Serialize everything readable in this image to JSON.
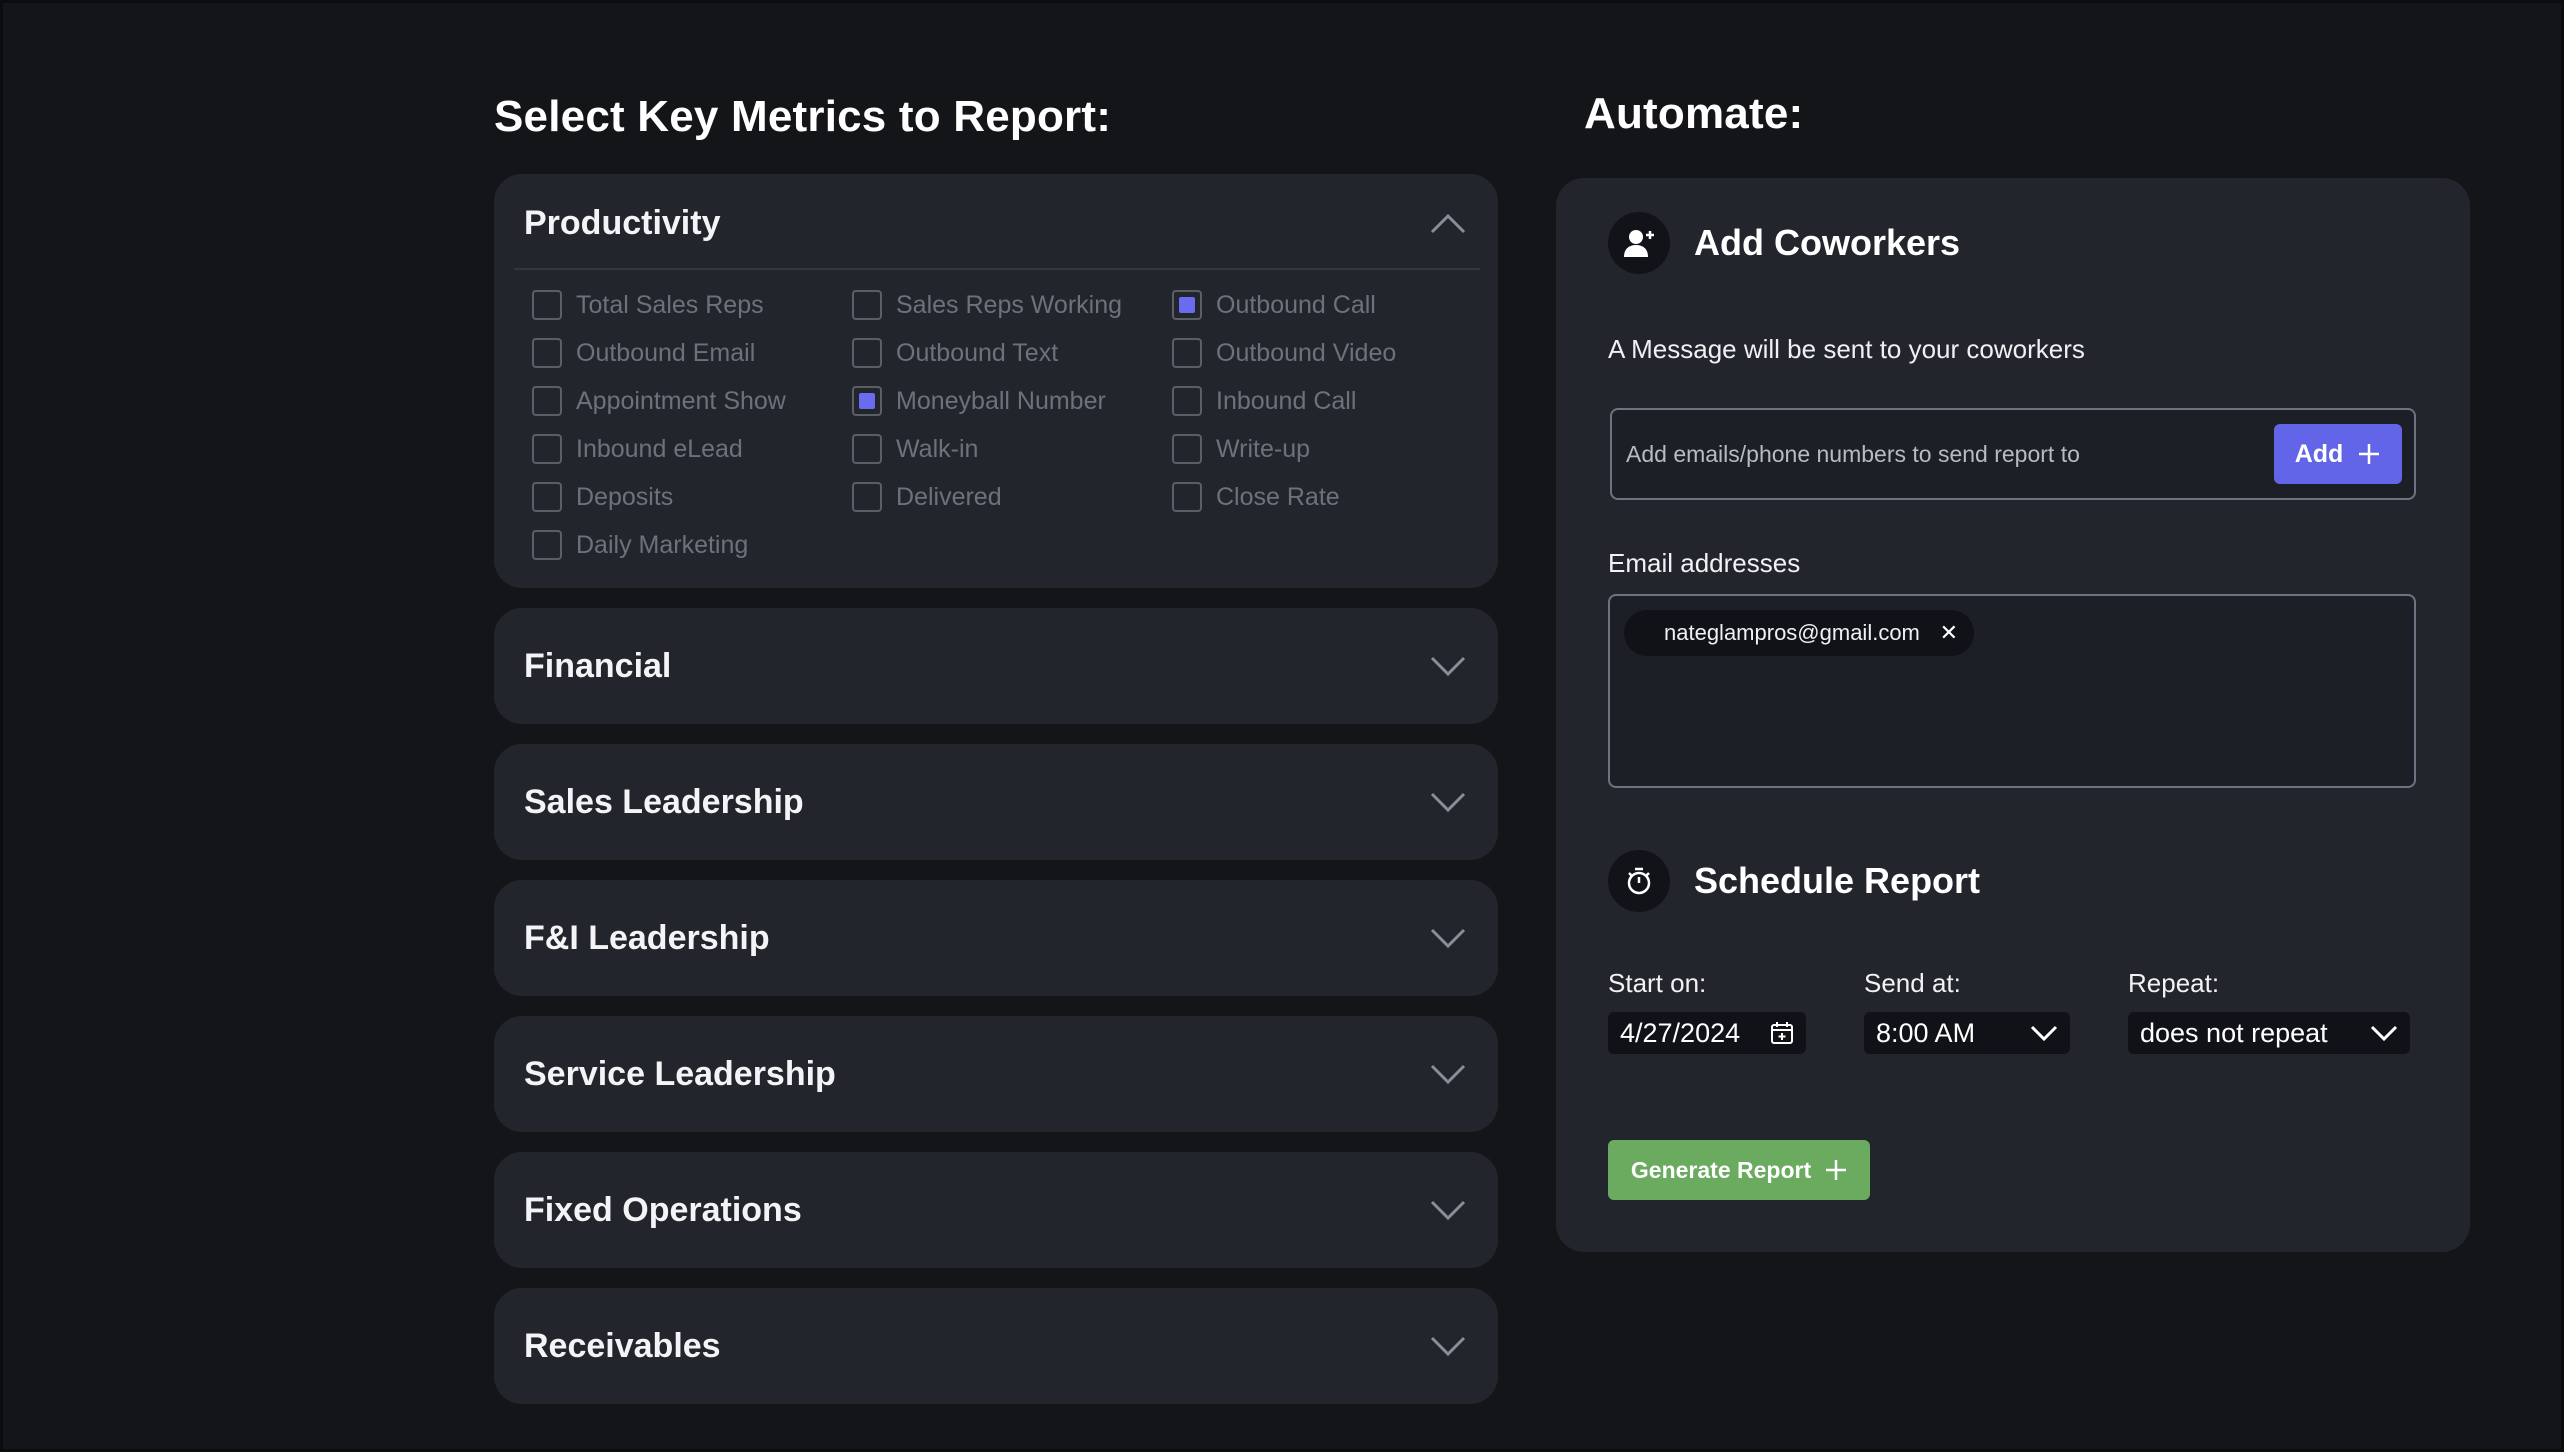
{
  "metrics_section": {
    "title": "Select Key Metrics to Report:",
    "categories": [
      {
        "title": "Productivity",
        "expanded": true,
        "columns": [
          [
            {
              "label": "Total Sales Reps",
              "checked": false
            },
            {
              "label": "Outbound Email",
              "checked": false
            },
            {
              "label": "Appointment Show",
              "checked": false
            },
            {
              "label": "Inbound eLead",
              "checked": false
            },
            {
              "label": "Deposits",
              "checked": false
            },
            {
              "label": "Daily Marketing",
              "checked": false
            }
          ],
          [
            {
              "label": "Sales Reps Working",
              "checked": false
            },
            {
              "label": "Outbound Text",
              "checked": false
            },
            {
              "label": "Moneyball Number",
              "checked": true
            },
            {
              "label": "Walk-in",
              "checked": false
            },
            {
              "label": "Delivered",
              "checked": false
            }
          ],
          [
            {
              "label": "Outbound Call",
              "checked": true
            },
            {
              "label": "Outbound Video",
              "checked": false
            },
            {
              "label": "Inbound Call",
              "checked": false
            },
            {
              "label": "Write-up",
              "checked": false
            },
            {
              "label": "Close Rate",
              "checked": false
            }
          ]
        ]
      },
      {
        "title": "Financial",
        "expanded": false
      },
      {
        "title": "Sales Leadership",
        "expanded": false
      },
      {
        "title": "F&I Leadership",
        "expanded": false
      },
      {
        "title": "Service Leadership",
        "expanded": false
      },
      {
        "title": "Fixed Operations",
        "expanded": false
      },
      {
        "title": "Receivables",
        "expanded": false
      }
    ]
  },
  "automate": {
    "title": "Automate:",
    "add_coworkers": {
      "title": "Add Coworkers",
      "icon": "add-user-icon",
      "message": "A Message will be sent to your coworkers",
      "input_placeholder": "Add emails/phone numbers to send report to",
      "input_value": "",
      "add_label": "Add"
    },
    "email_addresses": {
      "label": "Email addresses",
      "chips": [
        "nateglampros@gmail.com"
      ]
    },
    "schedule": {
      "title": "Schedule Report",
      "icon": "stopwatch-icon",
      "start_label": "Start on:",
      "start_value": "4/27/2024",
      "send_label": "Send at:",
      "send_value": "8:00 AM",
      "repeat_label": "Repeat:",
      "repeat_value": "does not repeat"
    },
    "generate_label": "Generate Report"
  },
  "colors": {
    "background": "#141519",
    "card": "#23252d",
    "accent_purple": "#6265e8",
    "accent_green": "#6aab60"
  }
}
